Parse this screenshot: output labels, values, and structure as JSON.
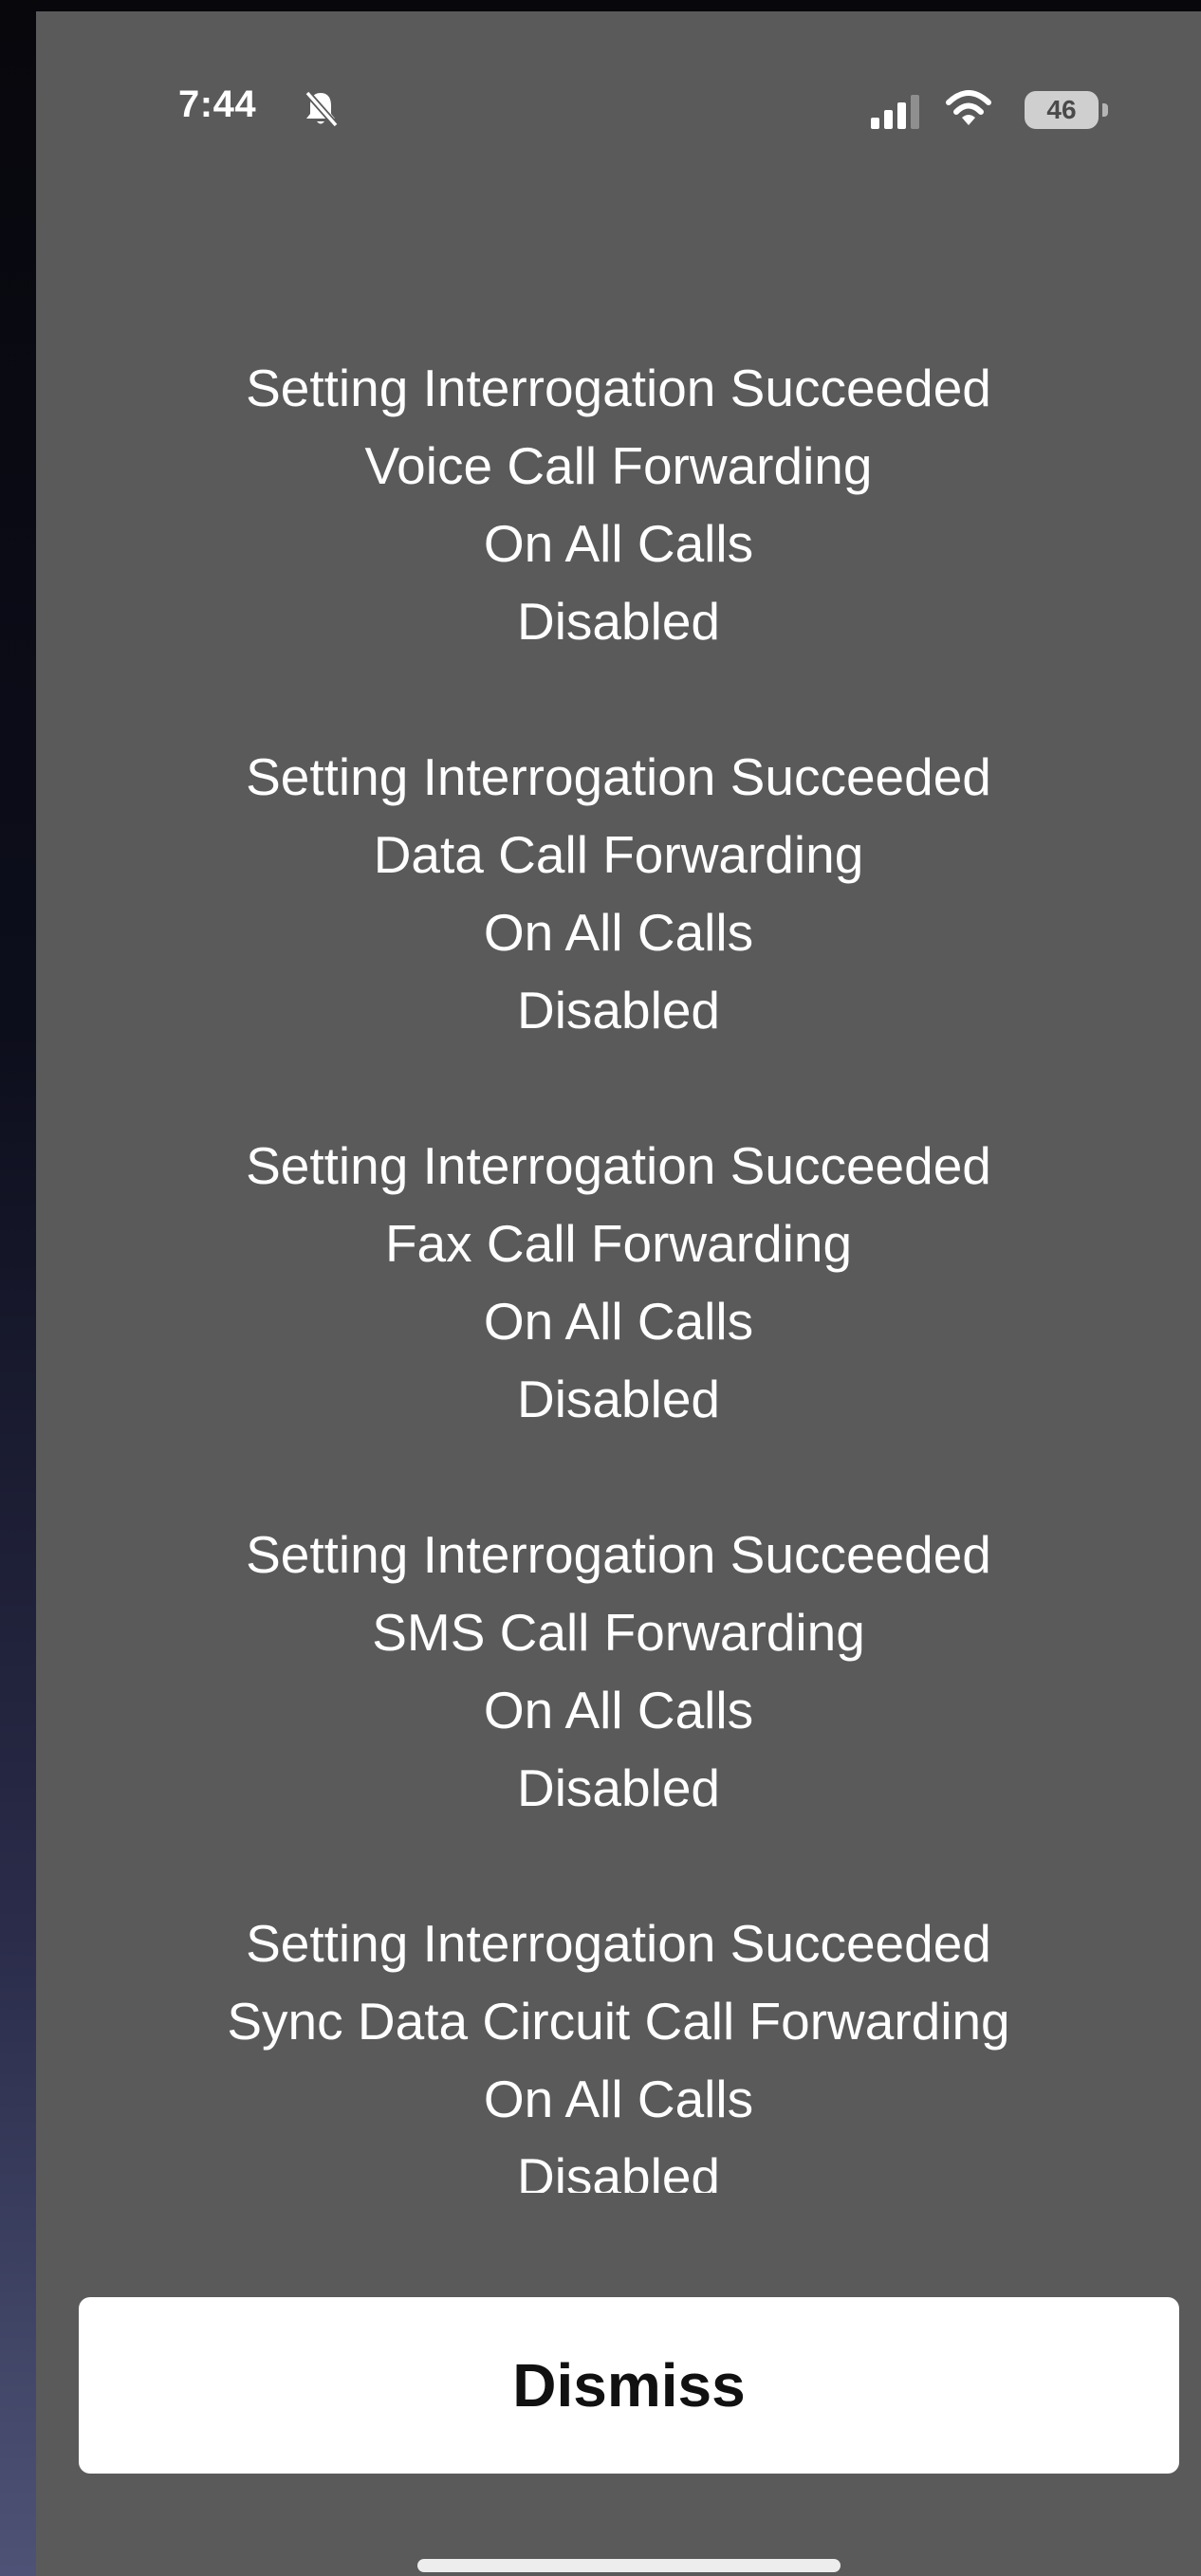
{
  "status_bar": {
    "time": "7:44",
    "battery_level": "46",
    "icons": [
      "bell-slash-icon",
      "signal-icon",
      "wifi-icon",
      "battery-icon"
    ]
  },
  "message_blocks": [
    {
      "status": "Setting Interrogation Succeeded",
      "service": "Voice Call Forwarding",
      "condition": "On All Calls",
      "state": "Disabled"
    },
    {
      "status": "Setting Interrogation Succeeded",
      "service": "Data Call Forwarding",
      "condition": "On All Calls",
      "state": "Disabled"
    },
    {
      "status": "Setting Interrogation Succeeded",
      "service": "Fax Call Forwarding",
      "condition": "On All Calls",
      "state": "Disabled"
    },
    {
      "status": "Setting Interrogation Succeeded",
      "service": "SMS Call Forwarding",
      "condition": "On All Calls",
      "state": "Disabled"
    },
    {
      "status": "Setting Interrogation Succeeded",
      "service": "Sync Data Circuit Call Forwarding",
      "condition": "On All Calls",
      "state": "Disabled"
    }
  ],
  "dismiss_label": "Dismiss",
  "colors": {
    "panel": "#5a5a5a",
    "text": "#ffffff",
    "button_bg": "#ffffff",
    "button_text": "#111111"
  }
}
